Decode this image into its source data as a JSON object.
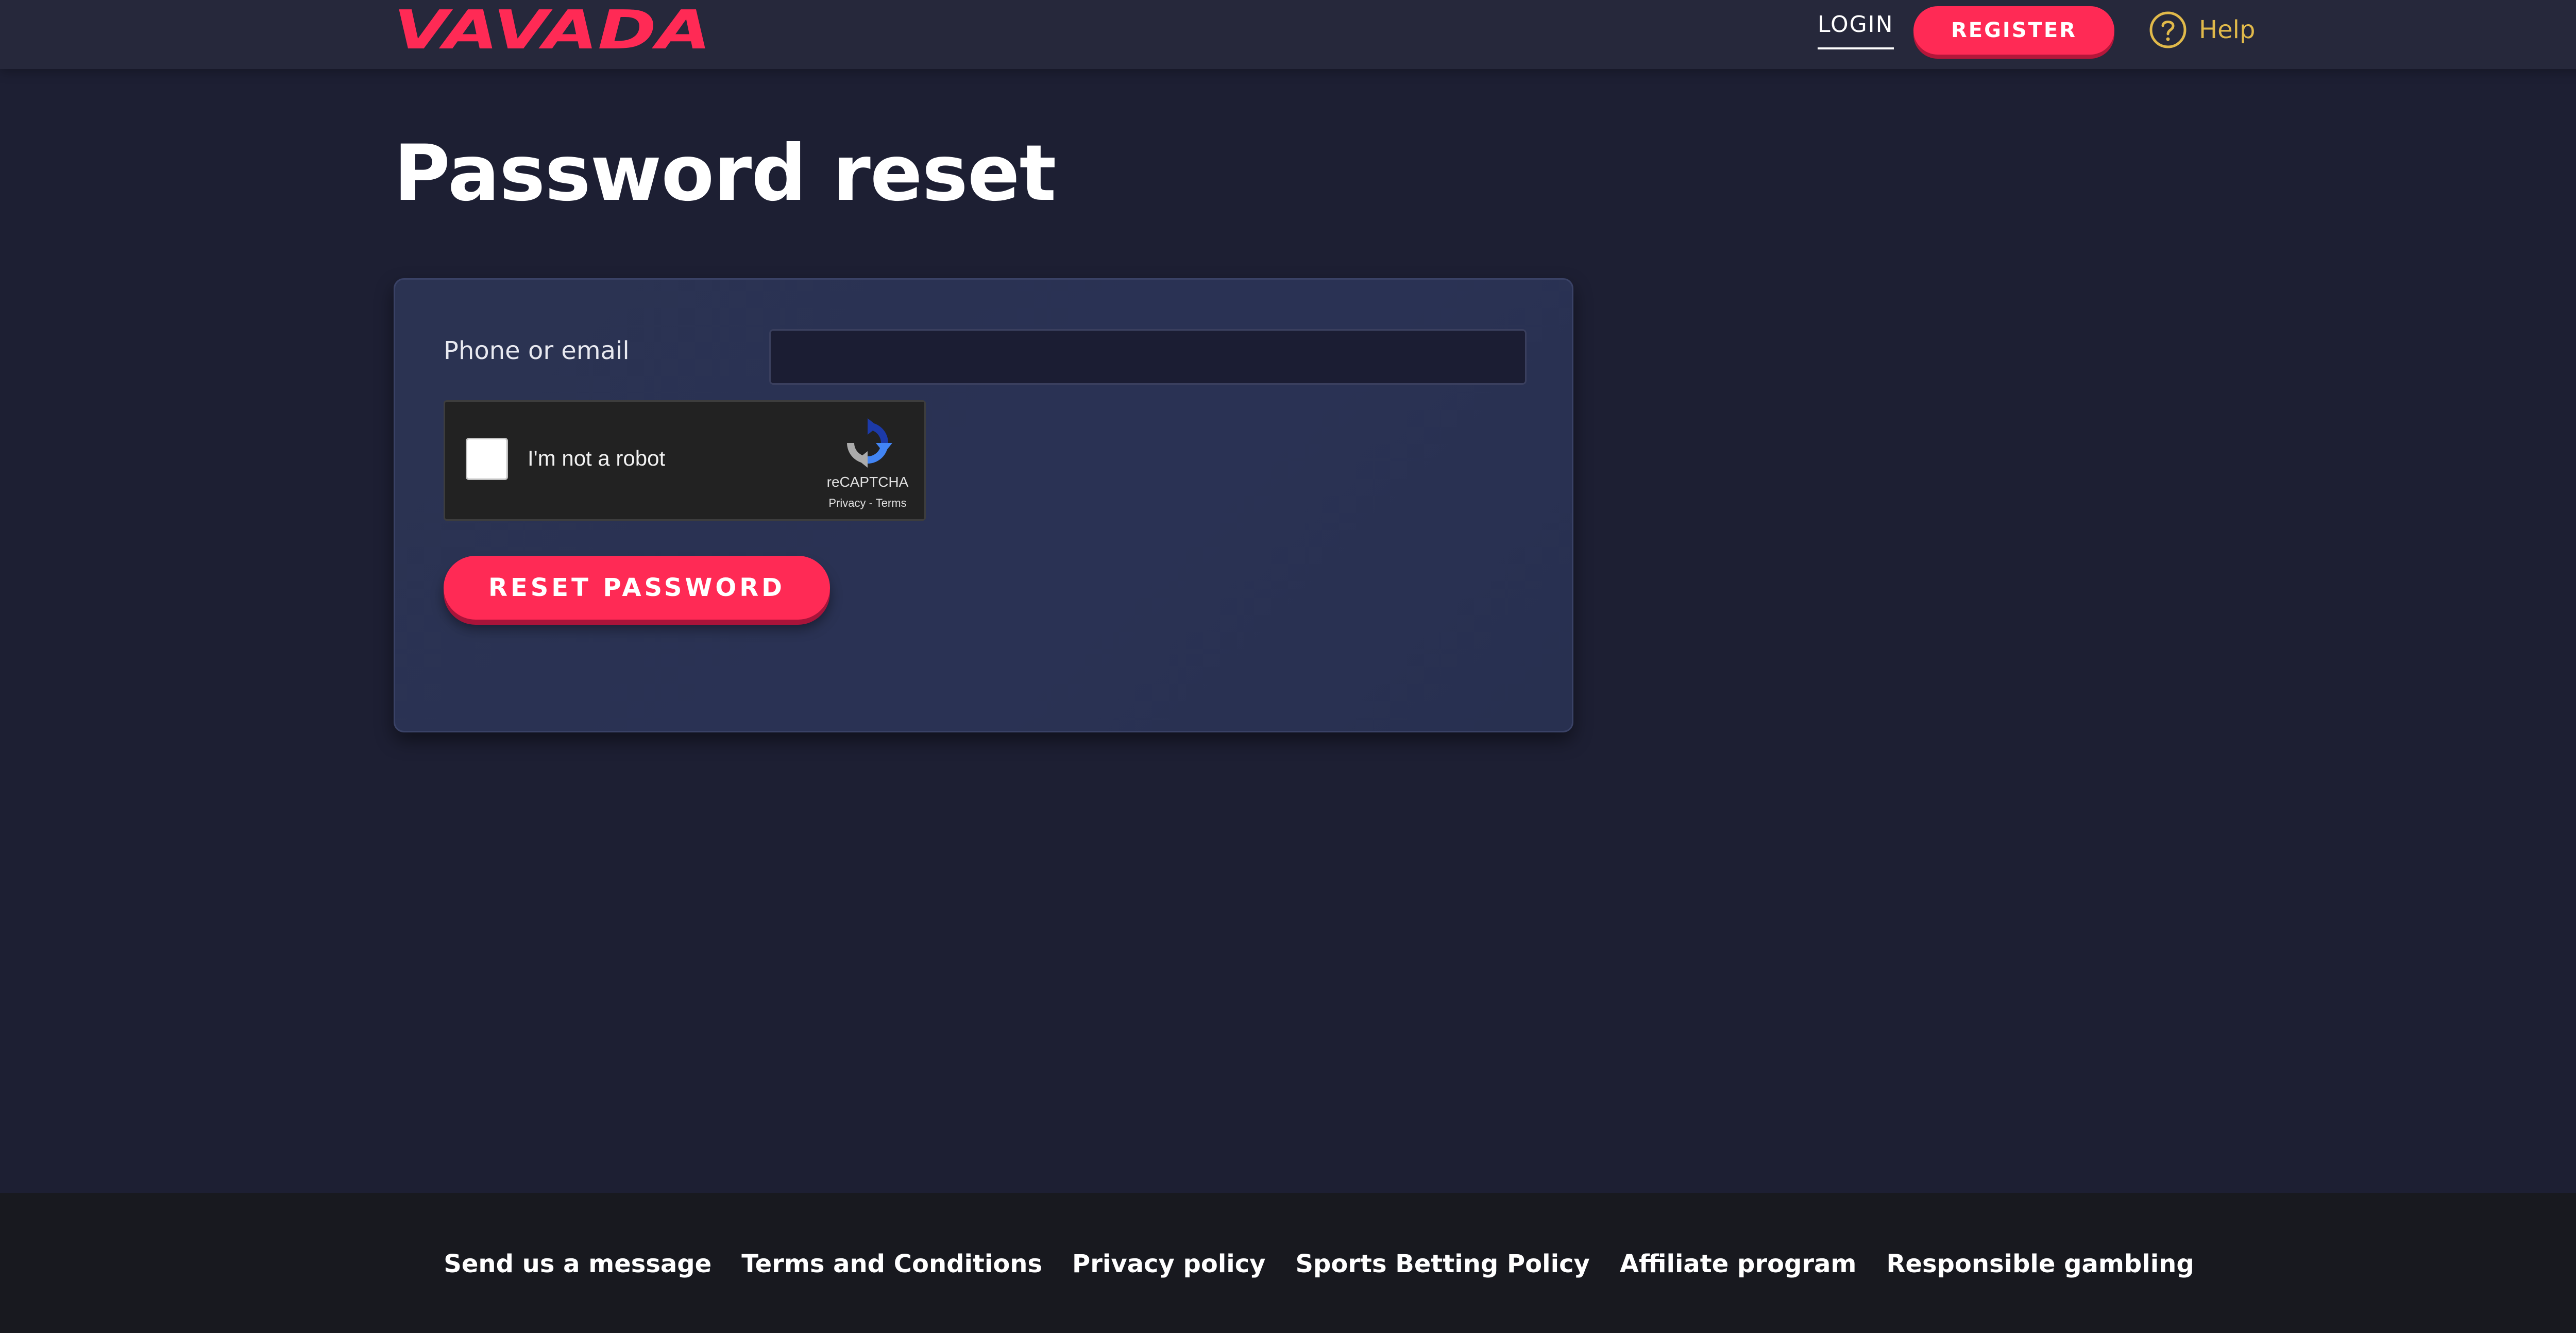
{
  "header": {
    "logo_text": "VAVADA",
    "login_label": "LOGIN",
    "register_label": "REGISTER",
    "help_label": "Help"
  },
  "main": {
    "title": "Password reset",
    "form": {
      "field_label": "Phone or email",
      "field_value": "",
      "captcha": {
        "checkbox_label": "I'm not a robot",
        "brand": "reCAPTCHA",
        "privacy_link": "Privacy",
        "separator": " - ",
        "terms_link": "Terms"
      },
      "submit_label": "RESET PASSWORD"
    }
  },
  "footer": {
    "links": [
      "Send us a message",
      "Terms and Conditions",
      "Privacy policy",
      "Sports Betting Policy",
      "Affiliate program",
      "Responsible gambling"
    ]
  },
  "colors": {
    "accent": "#ff2a55",
    "help": "#e0b94a",
    "background": "#1d1f33",
    "card": "#2a3254",
    "footer": "#18191f"
  }
}
